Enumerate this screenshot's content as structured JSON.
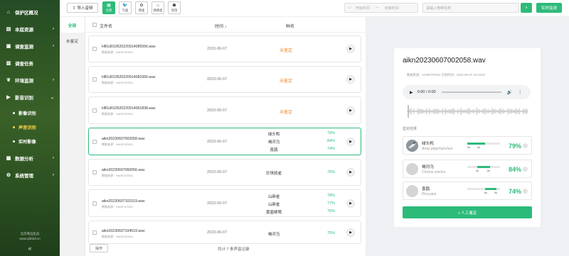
{
  "sidebar": {
    "items": [
      {
        "label": "保护区概况",
        "icon": "home-icon"
      },
      {
        "label": "本底资源",
        "icon": "book-icon"
      },
      {
        "label": "调查监测",
        "icon": "monitor-icon"
      },
      {
        "label": "调查任务",
        "icon": "clipboard-icon"
      },
      {
        "label": "环境监测",
        "icon": "leaf-icon"
      },
      {
        "label": "影音识别",
        "icon": "media-icon"
      }
    ],
    "sub_items": [
      {
        "label": "影像识别"
      },
      {
        "label": "声音识别"
      },
      {
        "label": "实时影像"
      }
    ],
    "bottom_items": [
      {
        "label": "数据分析",
        "icon": "chart-icon"
      },
      {
        "label": "系统管理",
        "icon": "settings-icon"
      }
    ],
    "footer_line1": "北京青远生态",
    "footer_line2": "www.qhbhd.cn",
    "active_sub": "声音识别"
  },
  "toolbar": {
    "import_label": "导入音频",
    "buttons": [
      {
        "label": "全部",
        "icon": "grid-icon"
      },
      {
        "label": "鸟类",
        "icon": "bird-icon"
      },
      {
        "label": "兽类",
        "icon": "paw-icon"
      },
      {
        "label": "两栖类",
        "icon": "frog-icon"
      },
      {
        "label": "昆虫",
        "icon": "bug-icon"
      }
    ],
    "date_start_placeholder": "开始时间",
    "date_sep": "—",
    "date_end_placeholder": "结束时间",
    "search_placeholder": "请输入物种名称",
    "monitor_label": "实时监测"
  },
  "filters": [
    "全部",
    "未鉴定"
  ],
  "list": {
    "headers": {
      "name": "文件名",
      "time": "时间 ↓",
      "species": "种名"
    },
    "items": [
      {
        "name": "HB1d010520220914085556.wav",
        "source": "数据来源：HA0ETAT501",
        "time": "2023-06-07",
        "status": "未鉴定",
        "species": []
      },
      {
        "name": "HB1d010520220914081666.wav",
        "source": "数据来源：HA0ETAT501",
        "time": "2023-06-07",
        "status": "未鉴定",
        "species": []
      },
      {
        "name": "HB1d010520220914061838.wav",
        "source": "数据来源：HA0ETAT501",
        "time": "2023-06-07",
        "status": "未鉴定",
        "species": []
      },
      {
        "name": "aikn20230607002058.wav",
        "source": "数据来源：HA0ETAT501",
        "time": "2023-06-07",
        "status": "",
        "species": [
          {
            "name": "绿头鸭",
            "pct": "79%"
          },
          {
            "name": "褐河乌",
            "pct": "84%"
          },
          {
            "name": "喜鹊",
            "pct": "74%"
          }
        ]
      },
      {
        "name": "aikn20230607060056.wav",
        "source": "数据来源：HA0ETAT501",
        "time": "2023-06-07",
        "status": "",
        "species": [
          {
            "name": "珍珠鸦雀",
            "pct": "75%"
          }
        ]
      },
      {
        "name": "aikn20230607101519.wav",
        "source": "数据来源：HA0ETAT501",
        "time": "2023-06-07",
        "status": "",
        "species": [
          {
            "name": "山麻雀",
            "pct": "78%"
          },
          {
            "name": "山麻雀",
            "pct": "77%"
          },
          {
            "name": "黄眉柳莺",
            "pct": "75%"
          }
        ]
      },
      {
        "name": "aikn20230607104519.wav",
        "source": "数据来源：HA0ETAT501",
        "time": "2023-06-07",
        "status": "",
        "species": [
          {
            "name": "褐河乌",
            "pct": "75%"
          }
        ]
      }
    ],
    "op_label": "操作",
    "total_text": "共计 7 条声音记录"
  },
  "detail": {
    "title": "aikn20230607002058.wav",
    "meta": "数据来源：HA0ETAT501    识别时间：2023-06-07 23:15:02",
    "audio_time": "0:00 / 0:00",
    "results_header": "鉴定结果",
    "results": [
      {
        "cn": "绿头鸭",
        "latin": "Anas platyrhynchos",
        "pct": "79%",
        "t0": "0s",
        "t1": "3s",
        "seg_start": 0.0,
        "seg_end": 0.55,
        "avatar": "bird-photo"
      },
      {
        "cn": "褐河乌",
        "latin": "Cinclus cinclus",
        "pct": "84%",
        "t0": "3s",
        "t1": "6s",
        "seg_start": 0.3,
        "seg_end": 0.7,
        "avatar": "placeholder"
      },
      {
        "cn": "喜鹊",
        "latin": "Pica pica",
        "pct": "74%",
        "t0": "6s",
        "t1": "9s",
        "seg_start": 0.55,
        "seg_end": 0.9,
        "avatar": "placeholder"
      }
    ],
    "manual_label": "+ 人工鉴定"
  },
  "colors": {
    "accent": "#2dbb7a",
    "warning": "#f08a2c",
    "sub_active": "#ffd84a"
  }
}
